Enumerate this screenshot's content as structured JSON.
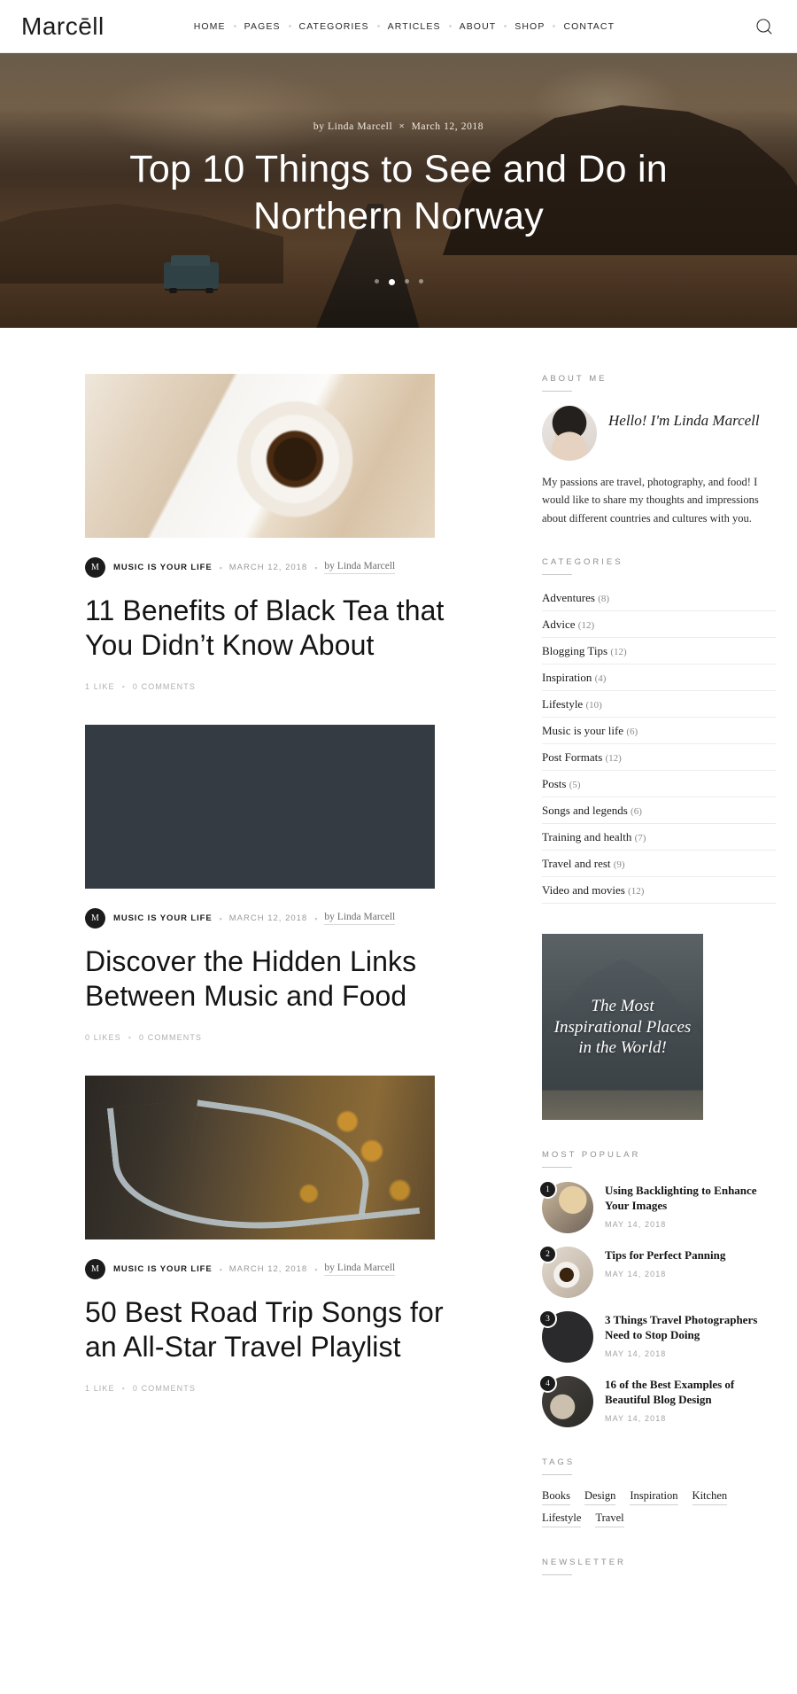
{
  "header": {
    "logo": "Marcēll",
    "nav": [
      "HOME",
      "PAGES",
      "CATEGORIES",
      "ARTICLES",
      "ABOUT",
      "SHOP",
      "CONTACT"
    ],
    "search_icon": "search-icon"
  },
  "hero": {
    "by_label": "by Linda Marcell",
    "separator": "✕",
    "date": "March 12, 2018",
    "title": "Top 10 Things to See and Do in Northern Norway",
    "dots": 4,
    "active_dot": 2
  },
  "posts": [
    {
      "category_initial": "M",
      "category": "MUSIC IS YOUR LIFE",
      "date": "MARCH 12, 2018",
      "author": "by Linda Marcell",
      "title": "11 Benefits of Black Tea that You Didn’t Know About",
      "likes": "1 LIKE",
      "comments": "0 COMMENTS",
      "thumb_class": "thumb-tea",
      "thumb_name": "post-image-black-tea"
    },
    {
      "category_initial": "M",
      "category": "MUSIC IS YOUR LIFE",
      "date": "MARCH 12, 2018",
      "author": "by Linda Marcell",
      "title": "Discover the Hidden Links Between Music and Food",
      "likes": "0 LIKES",
      "comments": "0 COMMENTS",
      "thumb_class": "thumb-food",
      "thumb_name": "post-image-music-and-food"
    },
    {
      "category_initial": "M",
      "category": "MUSIC IS YOUR LIFE",
      "date": "MARCH 12, 2018",
      "author": "by Linda Marcell",
      "title": "50 Best Road Trip Songs for an All-Star Travel Playlist",
      "likes": "1 LIKE",
      "comments": "0 COMMENTS",
      "thumb_class": "thumb-road",
      "thumb_name": "post-image-road-trip-songs"
    }
  ],
  "sidebar": {
    "about": {
      "title": "ABOUT ME",
      "greeting": "Hello! I'm Linda Marcell",
      "text": "My passions are travel, photography, and food! I would like to share my thoughts and impressions about different countries and cultures with you."
    },
    "categories": {
      "title": "CATEGORIES",
      "items": [
        {
          "name": "Adventures",
          "count": "(8)"
        },
        {
          "name": "Advice",
          "count": "(12)"
        },
        {
          "name": "Blogging Tips",
          "count": "(12)"
        },
        {
          "name": "Inspiration",
          "count": "(4)"
        },
        {
          "name": "Lifestyle",
          "count": "(10)"
        },
        {
          "name": "Music is your life",
          "count": "(6)"
        },
        {
          "name": "Post Formats",
          "count": "(12)"
        },
        {
          "name": "Posts",
          "count": "(5)"
        },
        {
          "name": "Songs and legends",
          "count": "(6)"
        },
        {
          "name": "Training and health",
          "count": "(7)"
        },
        {
          "name": "Travel and rest",
          "count": "(9)"
        },
        {
          "name": "Video and movies",
          "count": "(12)"
        }
      ]
    },
    "promo": {
      "text": "The Most Inspirational Places in the World!"
    },
    "most_popular": {
      "title": "MOST POPULAR",
      "items": [
        {
          "num": "1",
          "title": "Using Backlighting to Enhance Your Images",
          "date": "MAY 14, 2018",
          "thumb_class": "pt1"
        },
        {
          "num": "2",
          "title": "Tips for Perfect Panning",
          "date": "MAY 14, 2018",
          "thumb_class": "pt2"
        },
        {
          "num": "3",
          "title": "3 Things Travel Photographers Need to Stop Doing",
          "date": "MAY 14, 2018",
          "thumb_class": "pt3"
        },
        {
          "num": "4",
          "title": "16 of the Best Examples of Beautiful Blog Design",
          "date": "MAY 14, 2018",
          "thumb_class": "pt4"
        }
      ]
    },
    "tags": {
      "title": "TAGS",
      "items": [
        "Books",
        "Design",
        "Inspiration",
        "Kitchen",
        "Lifestyle",
        "Travel"
      ]
    },
    "newsletter": {
      "title": "NEWSLETTER"
    }
  },
  "colors": {
    "text": "#1b1b1b",
    "muted": "#9a9a9a",
    "rule": "#ececec",
    "badge": "#1c1c1c"
  }
}
